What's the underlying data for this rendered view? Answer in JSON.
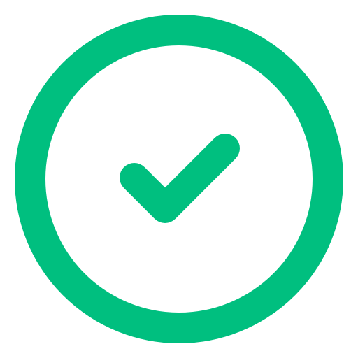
{
  "icon": {
    "name": "check-circle-icon",
    "color": "#00BF7F",
    "background": "#FFFFFF"
  }
}
